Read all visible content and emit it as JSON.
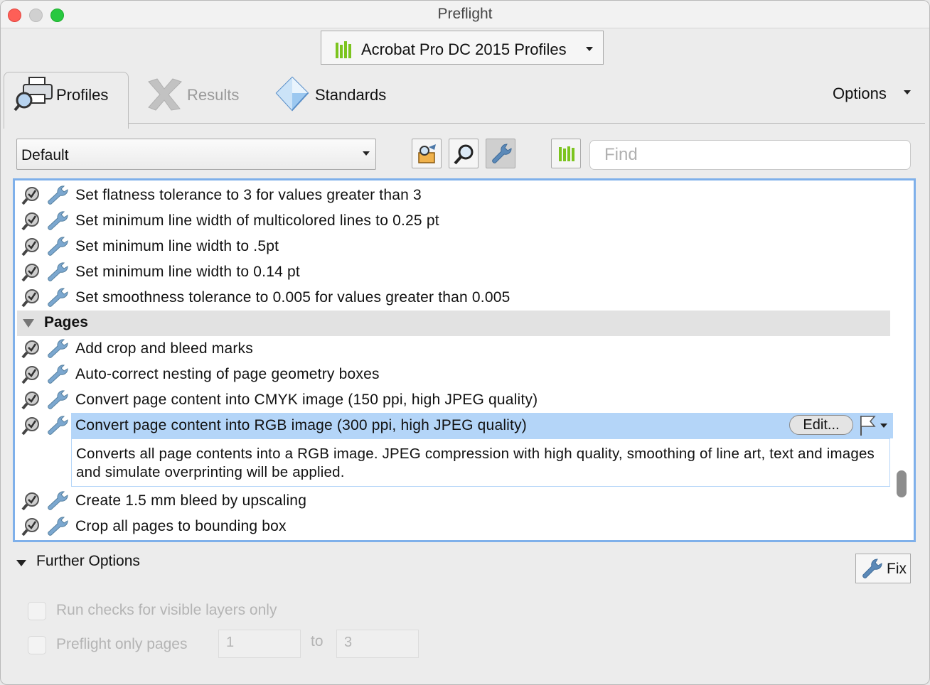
{
  "window": {
    "title": "Preflight"
  },
  "profile_selector": {
    "label": "Acrobat Pro DC 2015 Profiles"
  },
  "tabs": [
    {
      "label": "Profiles",
      "active": true
    },
    {
      "label": "Results",
      "active": false
    },
    {
      "label": "Standards",
      "active": false
    }
  ],
  "options": {
    "label": "Options"
  },
  "filter": {
    "value": "Default"
  },
  "search": {
    "placeholder": "Find"
  },
  "list": {
    "rows_top": [
      "Set flatness tolerance to 3 for values greater than 3",
      "Set minimum line width of multicolored lines to 0.25 pt",
      "Set minimum line width to .5pt",
      "Set minimum line width to 0.14 pt",
      "Set smoothness tolerance to 0.005 for values greater than 0.005"
    ],
    "group": "Pages",
    "rows_pages": [
      "Add crop and bleed marks",
      "Auto-correct nesting of page geometry boxes",
      "Convert page content into CMYK image (150 ppi, high JPEG quality)"
    ],
    "selected": {
      "label": "Convert page content into RGB image (300 ppi, high JPEG quality)",
      "edit_label": "Edit...",
      "description": "Converts all page contents into a RGB image. JPEG compression with high quality, smoothing of line art, text and images and simulate overprinting will be applied."
    },
    "rows_bottom": [
      "Create 1.5 mm bleed by upscaling",
      "Crop all pages to bounding box"
    ]
  },
  "further_options": {
    "label": "Further Options",
    "visible_layers_label": "Run checks for visible layers only",
    "pages_only_label": "Preflight only pages",
    "from_value": "1",
    "to_label": "to",
    "to_value": "3"
  },
  "fix_button": {
    "label": "Fix"
  },
  "colors": {
    "selection": "#b4d5f8",
    "focus_ring": "#7fb0ea",
    "library_green": "#7cc41f"
  }
}
